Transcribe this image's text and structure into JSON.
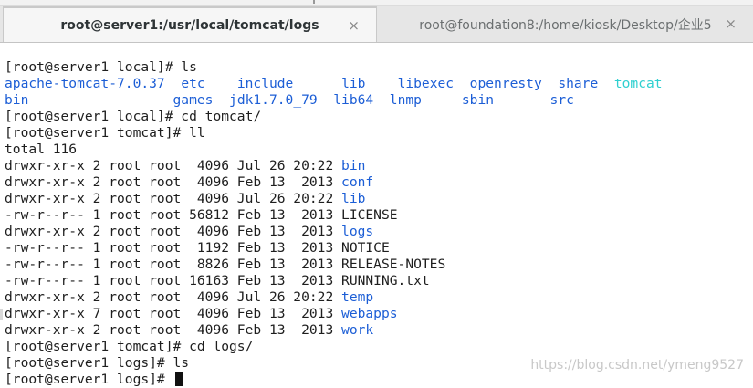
{
  "tabs": [
    {
      "title": "root@server1:/usr/local/tomcat/logs",
      "close": "×"
    },
    {
      "title": "root@foundation8:/home/kiosk/Desktop/企业5",
      "close": "×"
    }
  ],
  "terminal": {
    "l1": "[root@server1 local]# ls",
    "ls": {
      "r1": [
        "apache-tomcat-7.0.37",
        "etc",
        "include",
        "lib",
        "libexec",
        "openresty",
        "share",
        "tomcat"
      ],
      "r2": [
        "bin",
        "games",
        "jdk1.7.0_79",
        "lib64",
        "lnmp",
        "sbin",
        "src"
      ]
    },
    "l4": "[root@server1 local]# cd tomcat/",
    "l5": "[root@server1 tomcat]# ll",
    "l6": "total 116",
    "ll": [
      {
        "meta": "drwxr-xr-x 2 root root  4096 Jul 26 20:22 ",
        "name": "bin"
      },
      {
        "meta": "drwxr-xr-x 2 root root  4096 Feb 13  2013 ",
        "name": "conf"
      },
      {
        "meta": "drwxr-xr-x 2 root root  4096 Jul 26 20:22 ",
        "name": "lib"
      },
      {
        "meta": "-rw-r--r-- 1 root root 56812 Feb 13  2013 ",
        "name": "LICENSE"
      },
      {
        "meta": "drwxr-xr-x 2 root root  4096 Feb 13  2013 ",
        "name": "logs"
      },
      {
        "meta": "-rw-r--r-- 1 root root  1192 Feb 13  2013 ",
        "name": "NOTICE"
      },
      {
        "meta": "-rw-r--r-- 1 root root  8826 Feb 13  2013 ",
        "name": "RELEASE-NOTES"
      },
      {
        "meta": "-rw-r--r-- 1 root root 16163 Feb 13  2013 ",
        "name": "RUNNING.txt"
      },
      {
        "meta": "drwxr-xr-x 2 root root  4096 Jul 26 20:22 ",
        "name": "temp"
      },
      {
        "meta": "drwxr-xr-x 7 root root  4096 Feb 13  2013 ",
        "name": "webapps"
      },
      {
        "meta": "drwxr-xr-x 2 root root  4096 Feb 13  2013 ",
        "name": "work"
      }
    ],
    "l18": "[root@server1 tomcat]# cd logs/",
    "l19": "[root@server1 logs]# ls",
    "l20": "[root@server1 logs]# "
  },
  "watermark": "https://blog.csdn.net/ymeng9527",
  "colors": {
    "dir": "#1c5ed6",
    "link": "#2fd0d0",
    "text": "#1e1e1e"
  }
}
